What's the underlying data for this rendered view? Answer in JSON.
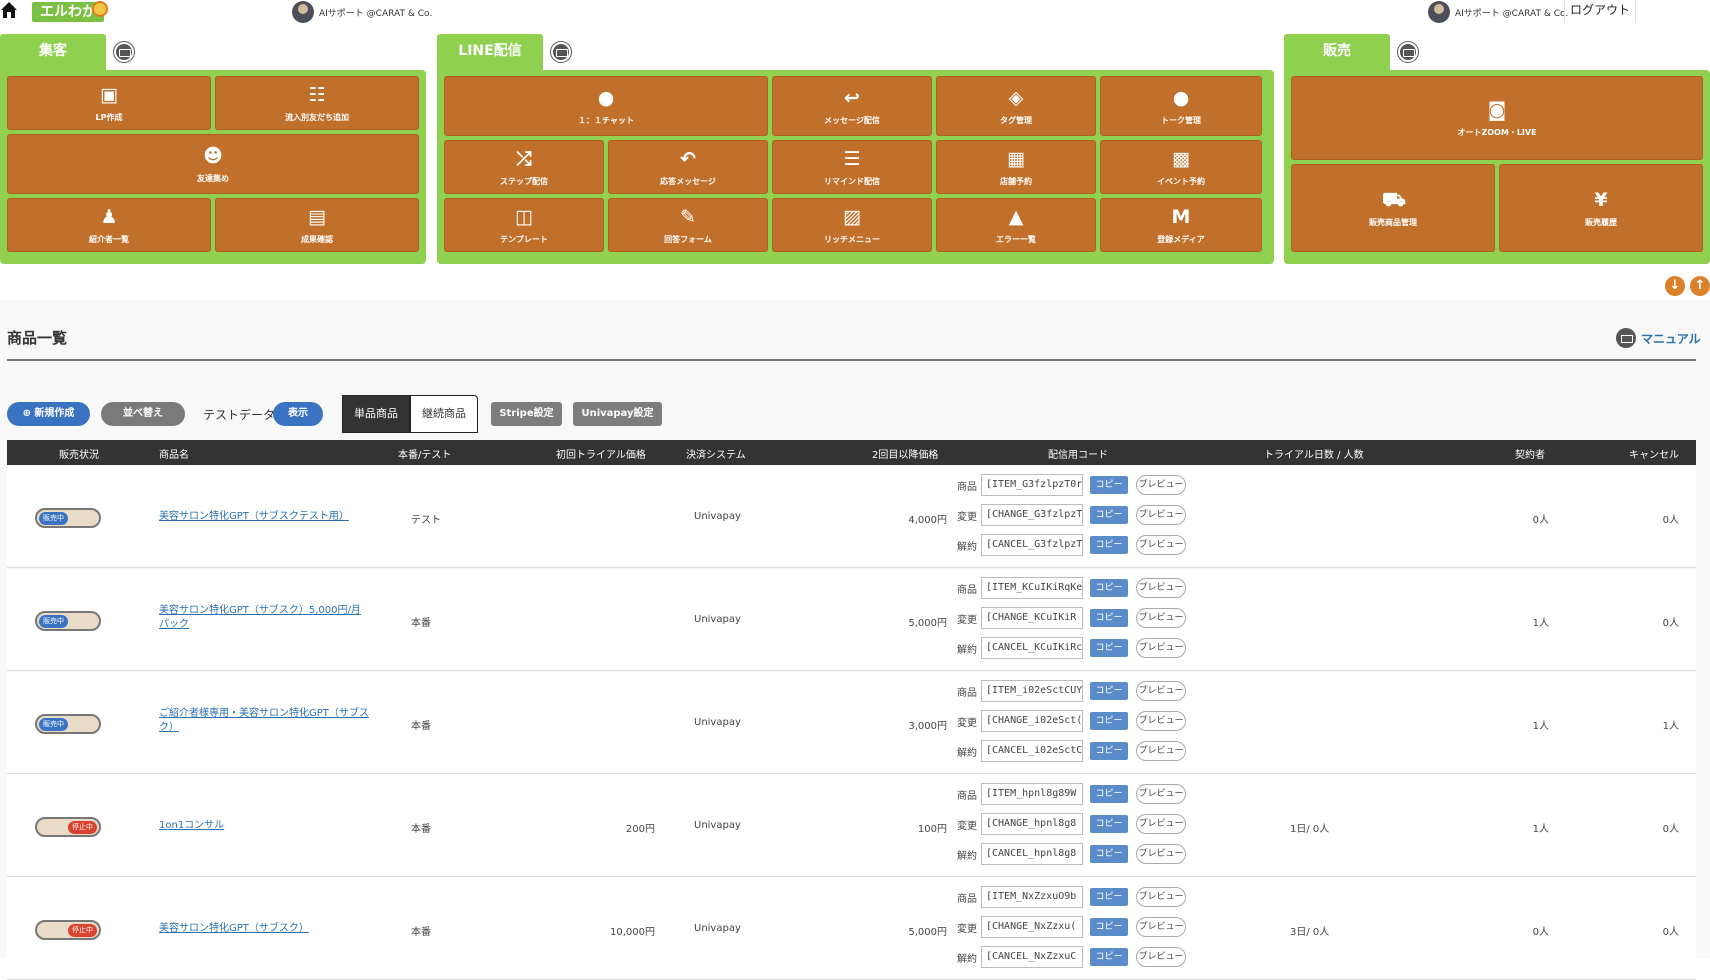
{
  "header": {
    "logo_text": "エルわか",
    "user_left": "AIサポート @CARAT & Co.",
    "user_right": "AIサポート @CARAT & Co.",
    "logout": "ログアウト"
  },
  "menus": {
    "shukyaku": {
      "title": "集客",
      "items": [
        {
          "label": "LP作成",
          "icon": "lp-icon"
        },
        {
          "label": "流入別友だち追加",
          "icon": "sitemap-icon"
        },
        {
          "label": "友達集め",
          "icon": "users-icon"
        },
        {
          "label": "紹介者一覧",
          "icon": "referrer-icon"
        },
        {
          "label": "成果確認",
          "icon": "chart-icon"
        }
      ]
    },
    "line": {
      "title": "LINE配信",
      "items": [
        {
          "label": "１：１チャット",
          "icon": "chat-icon"
        },
        {
          "label": "メッセージ配信",
          "icon": "reply-icon"
        },
        {
          "label": "タグ管理",
          "icon": "tag-icon"
        },
        {
          "label": "トーク管理",
          "icon": "speech-icon"
        },
        {
          "label": "ステップ配信",
          "icon": "shuffle-icon"
        },
        {
          "label": "応答メッセージ",
          "icon": "undo-icon"
        },
        {
          "label": "リマインド配信",
          "icon": "list-icon"
        },
        {
          "label": "店舗予約",
          "icon": "store-icon"
        },
        {
          "label": "イベント予約",
          "icon": "calendar-icon"
        },
        {
          "label": "テンプレート",
          "icon": "columns-icon"
        },
        {
          "label": "回答フォーム",
          "icon": "form-icon"
        },
        {
          "label": "リッチメニュー",
          "icon": "image-icon"
        },
        {
          "label": "エラー一覧",
          "icon": "warning-icon"
        },
        {
          "label": "登録メディア",
          "icon": "map-icon"
        }
      ]
    },
    "hanbai": {
      "title": "販売",
      "items": [
        {
          "label": "オートZOOM・LIVE",
          "icon": "video-icon"
        },
        {
          "label": "販売商品管理",
          "icon": "cart-icon"
        },
        {
          "label": "販売履歴",
          "icon": "money-bag-icon"
        }
      ]
    }
  },
  "page": {
    "title": "商品一覧",
    "manual": "マニュアル"
  },
  "toolbar": {
    "new": "⊕ 新規作成",
    "sort": "並べ替え",
    "testdata_label": "テストデータ",
    "show": "表示",
    "tab_single": "単品商品",
    "tab_continuous": "継続商品",
    "stripe": "Stripe設定",
    "univapay": "Univapay設定"
  },
  "table": {
    "headers": [
      "販売状況",
      "商品名",
      "本番/テスト",
      "初回トライアル価格",
      "決済システム",
      "2回目以降価格",
      "配信用コード",
      "トライアル日数 / 人数",
      "契約者",
      "キャンセル"
    ],
    "code_labels": [
      "商品",
      "変更",
      "解約"
    ],
    "copy_label": "コピー",
    "preview_label": "プレビュー",
    "rows": [
      {
        "status": "販売中",
        "status_on": true,
        "name": "美容サロン特化GPT（サブスクテスト用）",
        "env": "テスト",
        "trial_price": "",
        "system": "Univapay",
        "price": "4,000円",
        "codes": [
          "[ITEM_G3fzlpzT0r]",
          "[CHANGE_G3fzlpzT",
          "[CANCEL_G3fzlpzT"
        ],
        "trial": "",
        "contracts": "0人",
        "cancels": "0人"
      },
      {
        "status": "販売中",
        "status_on": true,
        "name": "美容サロン特化GPT（サブスク）5,000円/月パック",
        "env": "本番",
        "trial_price": "",
        "system": "Univapay",
        "price": "5,000円",
        "codes": [
          "[ITEM_KCuIKiRqKe",
          "[CHANGE_KCuIKiR",
          "[CANCEL_KCuIKiRc"
        ],
        "trial": "",
        "contracts": "1人",
        "cancels": "0人"
      },
      {
        "status": "販売中",
        "status_on": true,
        "name": "ご紹介者様専用・美容サロン特化GPT（サブスク）",
        "env": "本番",
        "trial_price": "",
        "system": "Univapay",
        "price": "3,000円",
        "codes": [
          "[ITEM_i02eSctCUY",
          "[CHANGE_i02eSct(",
          "[CANCEL_i02eSctC"
        ],
        "trial": "",
        "contracts": "1人",
        "cancels": "1人"
      },
      {
        "status": "停止中",
        "status_on": false,
        "name": "1on1コンサル",
        "env": "本番",
        "trial_price": "200円",
        "system": "Univapay",
        "price": "100円",
        "codes": [
          "[ITEM_hpnl8g89W",
          "[CHANGE_hpnl8g8",
          "[CANCEL_hpnl8g8"
        ],
        "trial": "1日/ 0人",
        "contracts": "1人",
        "cancels": "0人"
      },
      {
        "status": "停止中",
        "status_on": false,
        "name": "美容サロン特化GPT（サブスク）",
        "env": "本番",
        "trial_price": "10,000円",
        "system": "Univapay",
        "price": "5,000円",
        "codes": [
          "[ITEM_NxZzxuO9b",
          "[CHANGE_NxZzxu(",
          "[CANCEL_NxZzxuC"
        ],
        "trial": "3日/ 0人",
        "contracts": "0人",
        "cancels": "0人"
      }
    ]
  }
}
